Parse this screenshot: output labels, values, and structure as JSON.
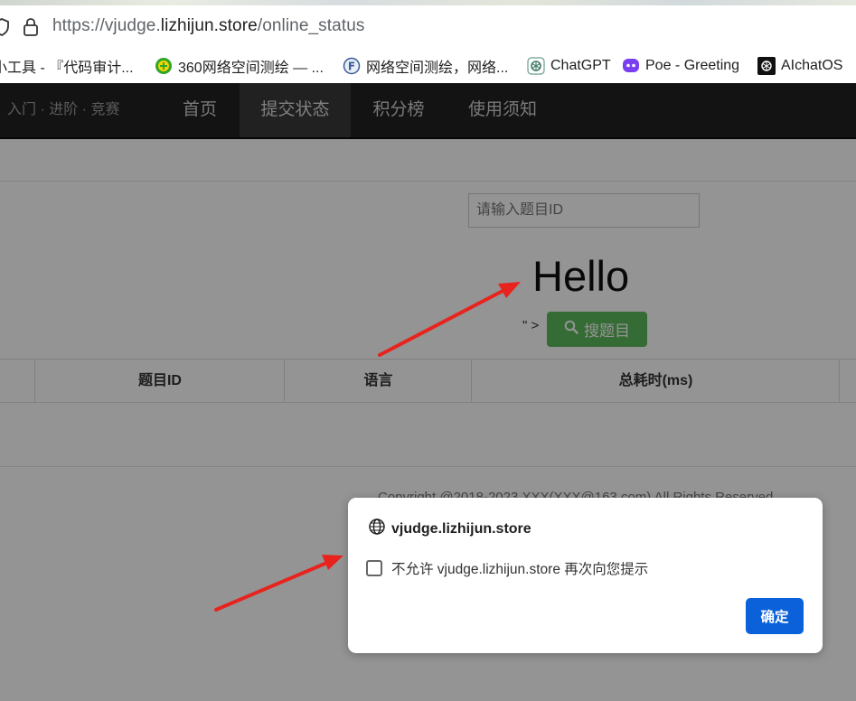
{
  "browser": {
    "url_prefix": "https://vjudge.",
    "url_host": "lizhijun.store",
    "url_path": "/online_status"
  },
  "bookmarks": [
    {
      "label": "小工具 - 『代码审计...",
      "icon": "none"
    },
    {
      "label": "360网络空间测绘 — ...",
      "icon": "360-icon"
    },
    {
      "label": "网络空间测绘，网络...",
      "icon": "fofa-icon"
    },
    {
      "label": "ChatGPT",
      "icon": "chatgpt-icon"
    },
    {
      "label": "Poe - Greeting",
      "icon": "poe-icon"
    },
    {
      "label": "AIchatOS",
      "icon": "aichatos-icon"
    }
  ],
  "site_nav": {
    "brand": "入门 · 进阶 · 竞赛",
    "items": [
      {
        "label": "首页",
        "active": false
      },
      {
        "label": "提交状态",
        "active": true
      },
      {
        "label": "积分榜",
        "active": false
      },
      {
        "label": "使用须知",
        "active": false
      }
    ]
  },
  "search": {
    "placeholder": "请输入题目ID",
    "injected_text": "Hello",
    "stray_text": "\" >",
    "button_label": "搜题目"
  },
  "table": {
    "headers": [
      "",
      "题目ID",
      "语言",
      "总耗时(ms)",
      ""
    ]
  },
  "footer": {
    "copyright": "Copyright @2018-2023 XXX(XXX@163.com) All Rights Reserved"
  },
  "dialog": {
    "title": "vjudge.lizhijun.store",
    "checkbox_label": "不允许 vjudge.lizhijun.store 再次向您提示",
    "checkbox_checked": false,
    "ok_label": "确定"
  },
  "colors": {
    "nav_bg": "#222222",
    "search_button": "#5cb85c",
    "ok_button": "#0b61da",
    "annotation_arrow": "#e8231e"
  }
}
